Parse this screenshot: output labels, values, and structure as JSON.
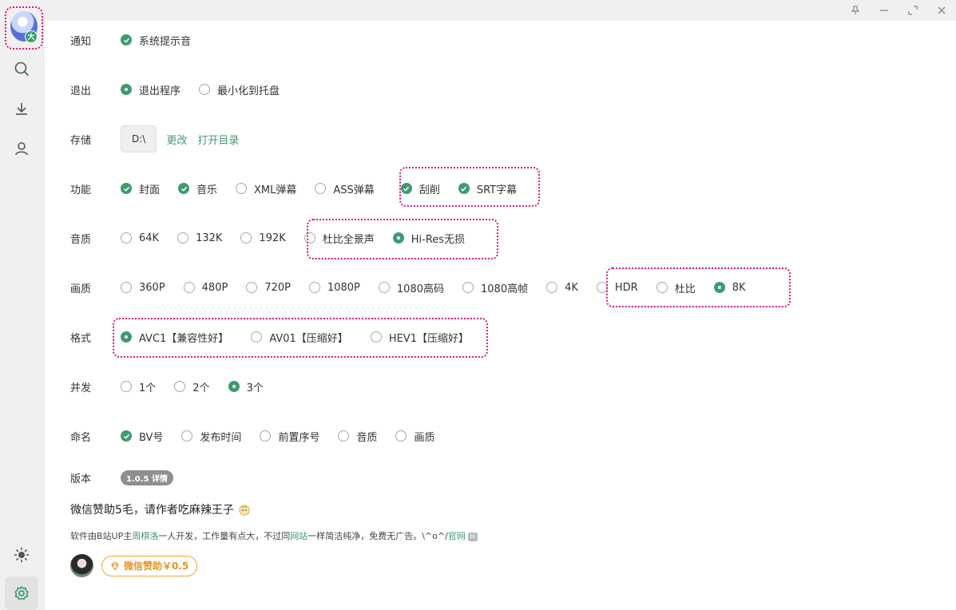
{
  "sidebar": {
    "avatar_badge": "大"
  },
  "settings": {
    "notify": {
      "label": "通知",
      "options": [
        "系统提示音"
      ]
    },
    "exit": {
      "label": "退出",
      "options": [
        "退出程序",
        "最小化到托盘"
      ]
    },
    "storage": {
      "label": "存储",
      "path": "D:\\",
      "change": "更改",
      "open_dir": "打开目录"
    },
    "features": {
      "label": "功能",
      "options": [
        "封面",
        "音乐",
        "XML弹幕",
        "ASS弹幕",
        "刮削",
        "SRT字幕"
      ]
    },
    "audio": {
      "label": "音质",
      "options": [
        "64K",
        "132K",
        "192K",
        "杜比全景声",
        "Hi-Res无损"
      ]
    },
    "video": {
      "label": "画质",
      "options": [
        "360P",
        "480P",
        "720P",
        "1080P",
        "1080高码",
        "1080高帧",
        "4K",
        "HDR",
        "杜比",
        "8K"
      ]
    },
    "format": {
      "label": "格式",
      "options": [
        "AVC1【兼容性好】",
        "AV01【压缩好】",
        "HEV1【压缩好】"
      ]
    },
    "concurrency": {
      "label": "并发",
      "options": [
        "1个",
        "2个",
        "3个"
      ]
    },
    "naming": {
      "label": "命名",
      "options": [
        "BV号",
        "发布时间",
        "前置序号",
        "音质",
        "画质"
      ]
    },
    "version": {
      "label": "版本",
      "pill": "1.0.5 详情"
    }
  },
  "footer": {
    "sponsor_title": "微信赞助5毛，请作者吃麻辣王子",
    "desc_1": "软件由B站UP主",
    "author": "周棋洛",
    "desc_2": "一人开发，工作量有点大，不过同",
    "site": "网站",
    "desc_3": "一样简洁纯净，免费无广告。\\^o^/",
    "official": "官网",
    "badge": "bi",
    "donate_label": "微信赞助￥0.5"
  },
  "colors": {
    "accent": "#3d9b6f",
    "highlight": "#e0157a",
    "donate": "#e8941f"
  }
}
